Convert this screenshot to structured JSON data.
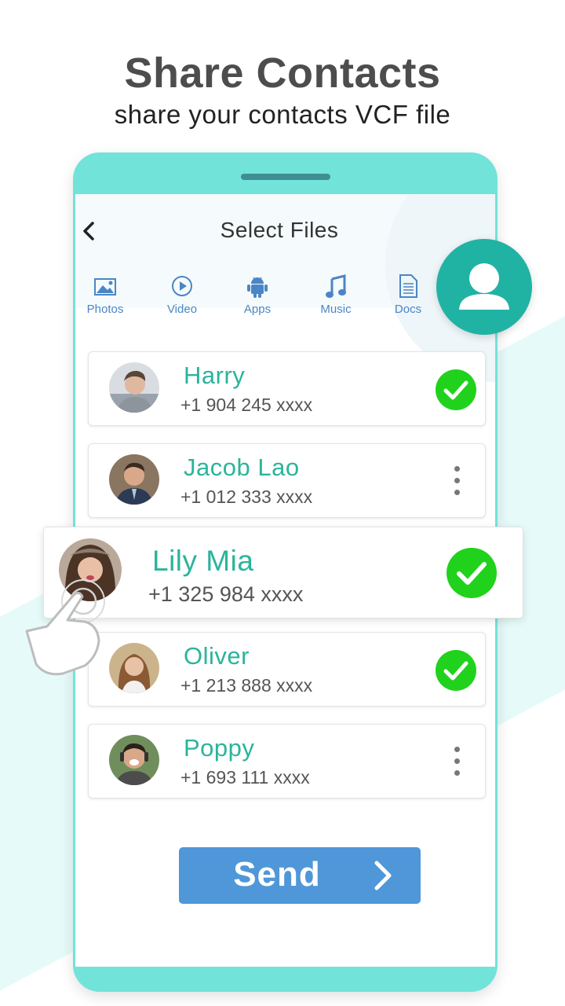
{
  "header": {
    "title": "Share Contacts",
    "subtitle": "share your contacts VCF file"
  },
  "screen": {
    "title": "Select Files",
    "back_icon": "chevron-left-icon",
    "tabs": [
      {
        "label": "Photos",
        "icon": "image-icon"
      },
      {
        "label": "Video",
        "icon": "play-circle-icon"
      },
      {
        "label": "Apps",
        "icon": "android-icon"
      },
      {
        "label": "Music",
        "icon": "music-note-icon"
      },
      {
        "label": "Docs",
        "icon": "document-icon"
      }
    ],
    "contacts": [
      {
        "name": "Harry",
        "phone": "+1 904 245 xxxx",
        "selected": true
      },
      {
        "name": "Jacob Lao",
        "phone": "+1 012 333 xxxx",
        "selected": false
      },
      {
        "name": "Lily Mia",
        "phone": "+1 325 984 xxxx",
        "selected": true,
        "highlighted": true
      },
      {
        "name": "Oliver",
        "phone": "+1 213 888 xxxx",
        "selected": true
      },
      {
        "name": "Poppy",
        "phone": "+1 693 111 xxxx",
        "selected": false
      }
    ],
    "send_label": "Send"
  },
  "colors": {
    "accent_teal": "#72e3d9",
    "name_green": "#2bb49b",
    "check_green": "#21d21c",
    "send_blue": "#4f97d8",
    "fab_teal": "#20b3a4",
    "tab_blue": "#4a86c5"
  }
}
